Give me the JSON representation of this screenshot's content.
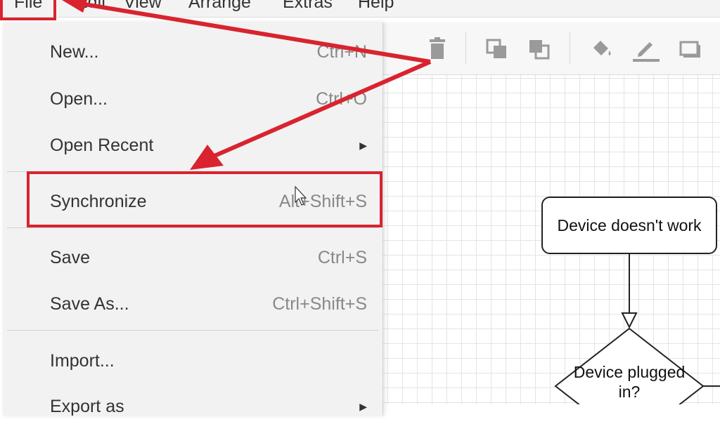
{
  "menubar": {
    "items": [
      {
        "label": "File"
      },
      {
        "label": "Edit"
      },
      {
        "label": "View"
      },
      {
        "label": "Arrange"
      },
      {
        "label": "Extras"
      },
      {
        "label": "Help"
      }
    ]
  },
  "toolbar": {
    "icons": [
      "delete-icon",
      "to-front-icon",
      "to-back-icon",
      "fill-color-icon",
      "line-color-icon",
      "shadow-icon"
    ]
  },
  "file_menu": {
    "items": [
      {
        "label": "New...",
        "shortcut": "Ctrl+N"
      },
      {
        "label": "Open...",
        "shortcut": "Ctrl+O"
      },
      {
        "label": "Open Recent",
        "submenu_icon": "chevron-right-icon"
      },
      {
        "label": "Synchronize",
        "shortcut": "Alt+Shift+S"
      },
      {
        "label": "Save",
        "shortcut": "Ctrl+S"
      },
      {
        "label": "Save As...",
        "shortcut": "Ctrl+Shift+S"
      },
      {
        "label": "Import...",
        "shortcut": ""
      },
      {
        "label": "Export as",
        "submenu_icon": "chevron-right-icon"
      }
    ]
  },
  "diagram": {
    "start_box": "Device doesn't work",
    "decision": "Device plugged in?"
  },
  "annotations": {
    "color": "#d9232f"
  }
}
